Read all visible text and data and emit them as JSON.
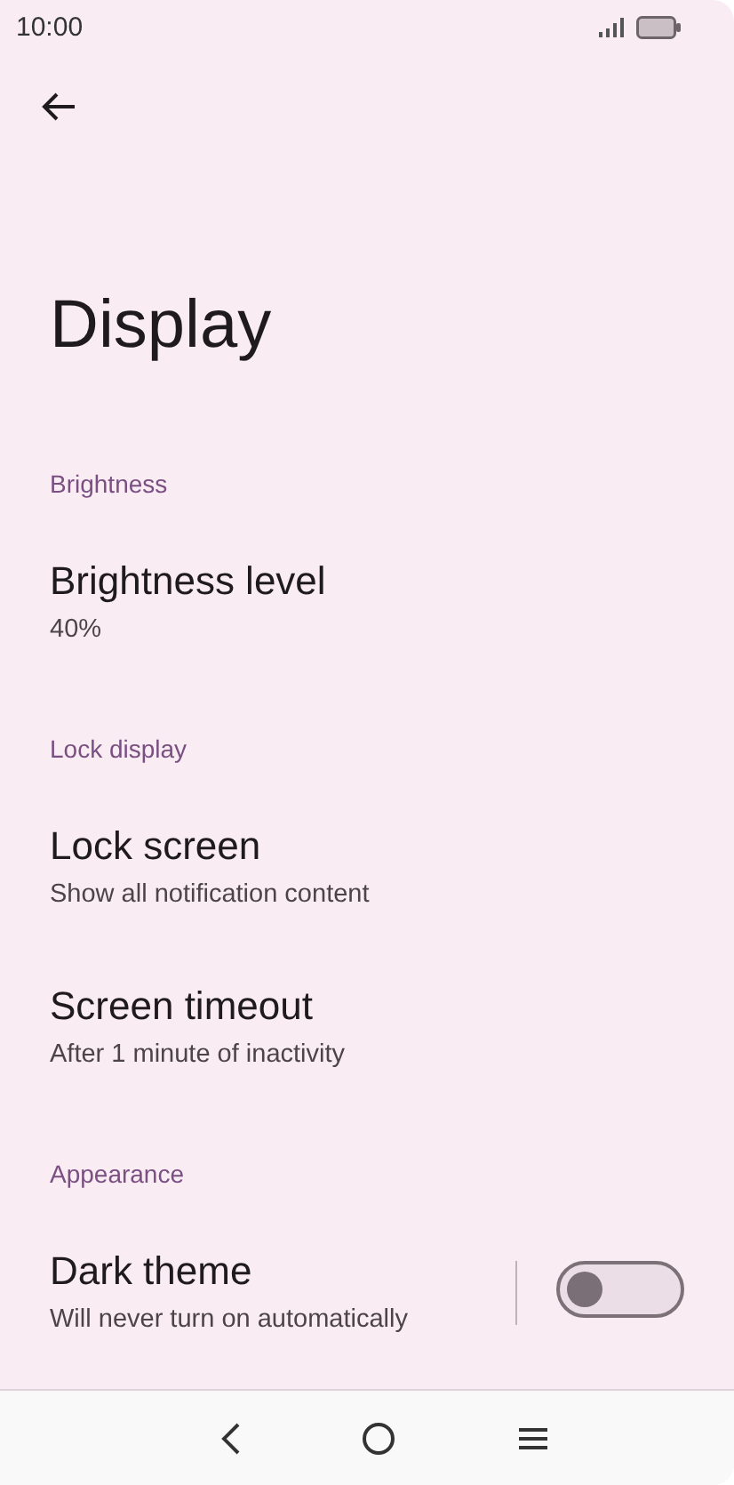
{
  "status_bar": {
    "time": "10:00"
  },
  "title": "Display",
  "sections": [
    {
      "header": "Brightness",
      "items": [
        {
          "kind": "text",
          "title": "Brightness level",
          "subtitle": "40%"
        }
      ]
    },
    {
      "header": "Lock display",
      "items": [
        {
          "kind": "text",
          "title": "Lock screen",
          "subtitle": "Show all notification content"
        },
        {
          "kind": "text",
          "title": "Screen timeout",
          "subtitle": "After 1 minute of inactivity"
        }
      ]
    },
    {
      "header": "Appearance",
      "items": [
        {
          "kind": "switch",
          "title": "Dark theme",
          "subtitle": "Will never turn on automatically",
          "on": false
        }
      ]
    }
  ]
}
